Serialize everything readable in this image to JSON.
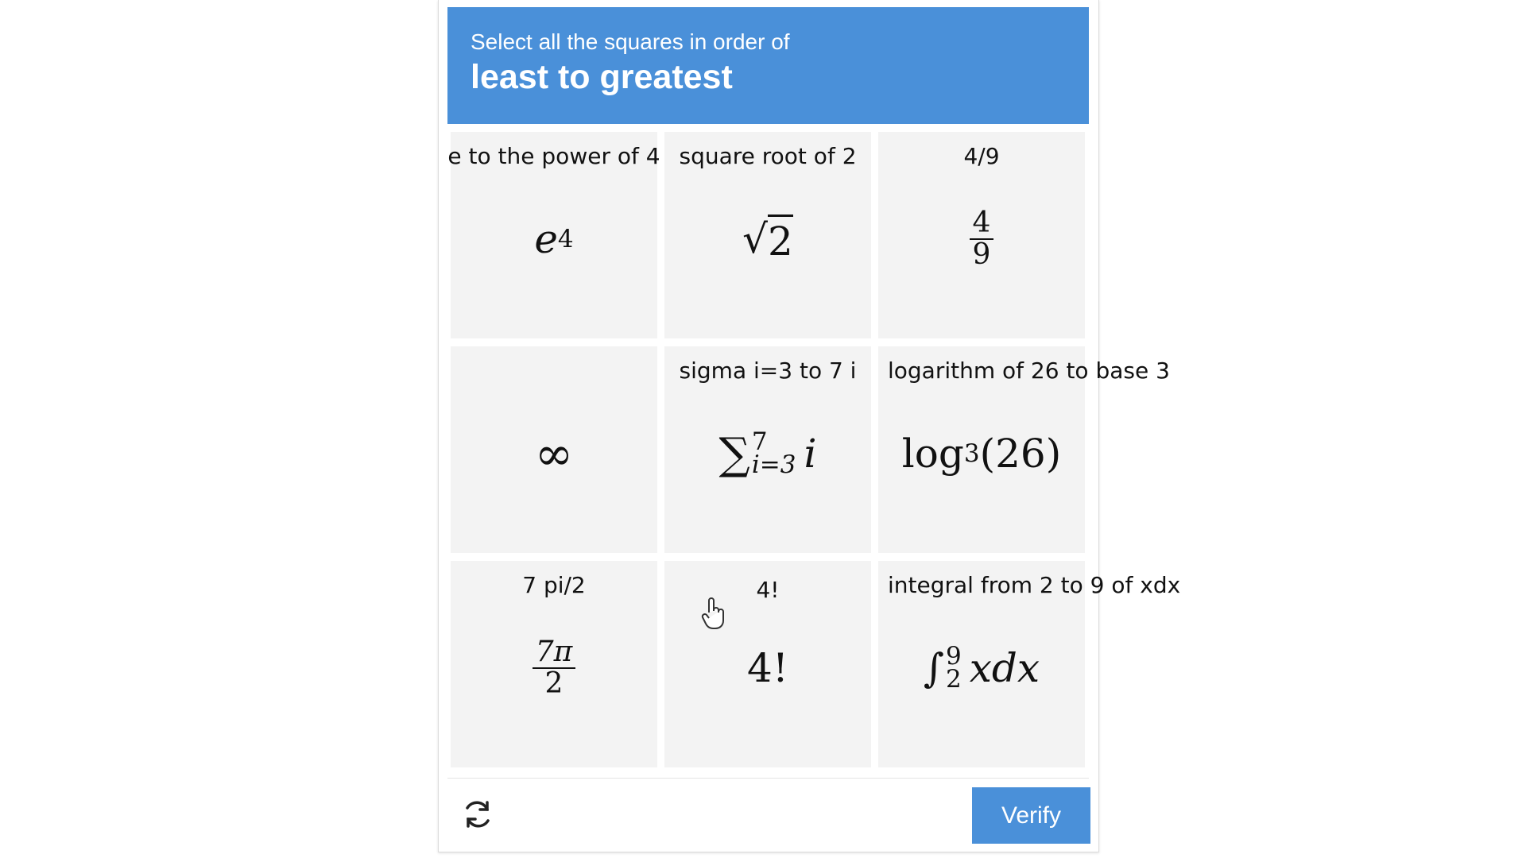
{
  "header": {
    "instruction": "Select all the squares in order of",
    "order": "least to greatest",
    "bg_color": "#4a90d9"
  },
  "tiles": [
    {
      "caption": "e to the power of 4",
      "base": "e",
      "exp": "4"
    },
    {
      "caption": "square root of 2",
      "radicand": "2"
    },
    {
      "caption": "4/9",
      "num": "4",
      "den": "9"
    },
    {
      "caption": "",
      "symbol": "∞"
    },
    {
      "caption": "sigma i=3 to 7 i",
      "sym": "∑",
      "upper": "7",
      "lower": "i=3",
      "body": "i"
    },
    {
      "caption": "logarithm of 26 to base 3",
      "fn": "log",
      "base": "3",
      "arg": "(26)"
    },
    {
      "caption": "7 pi/2",
      "num": "7π",
      "den": "2"
    },
    {
      "caption": "4!",
      "expr": "4!"
    },
    {
      "caption": "integral from 2 to 9 of xdx",
      "sym": "∫",
      "upper": "9",
      "lower": "2",
      "body": "xdx"
    }
  ],
  "footer": {
    "refresh_icon": "refresh-icon",
    "verify_label": "Verify",
    "verify_color": "#4a90d9"
  },
  "cursor_icon": "hand-pointer-icon"
}
